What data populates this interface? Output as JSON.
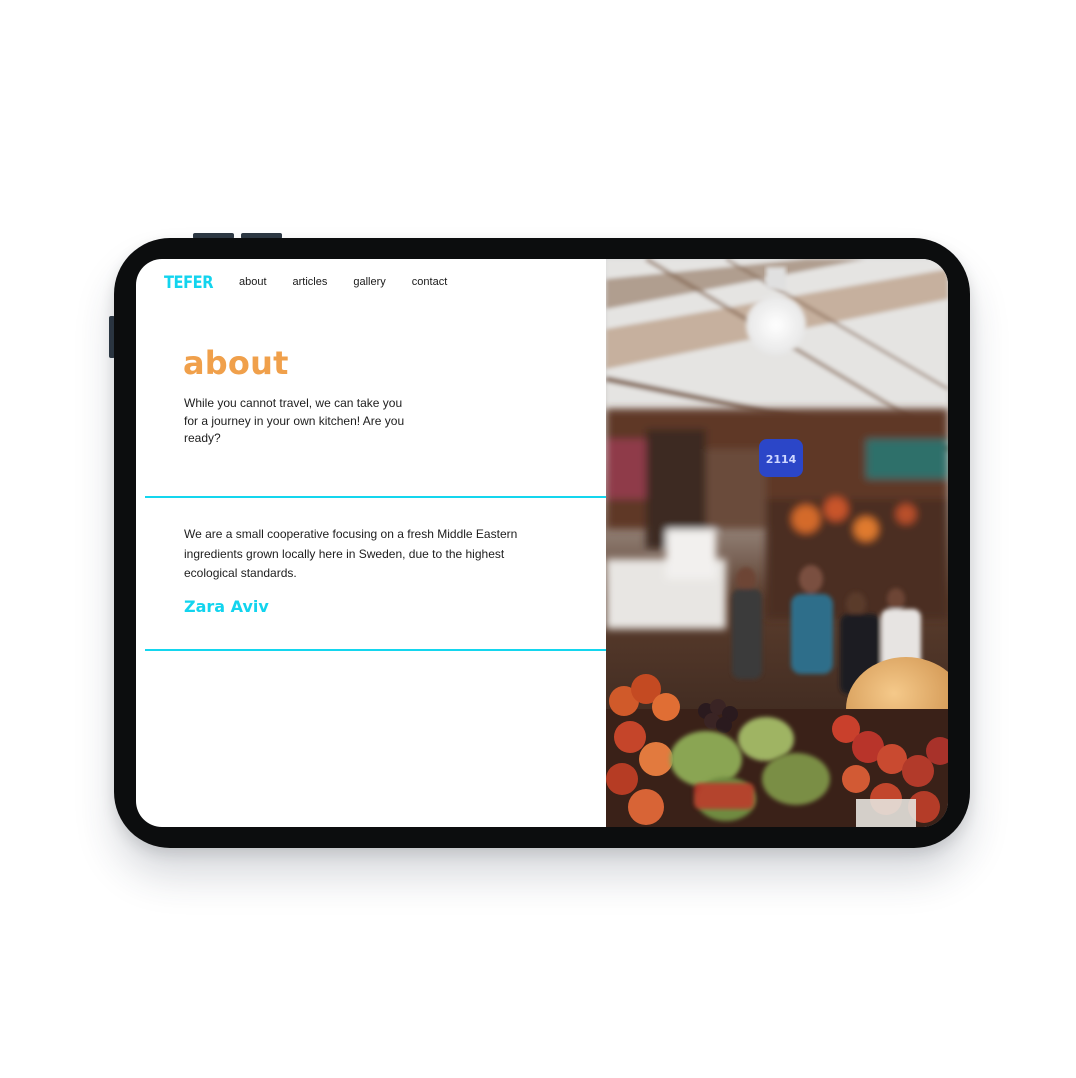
{
  "site": {
    "logo": "TEFER"
  },
  "nav": {
    "items": [
      {
        "label": "about"
      },
      {
        "label": "articles"
      },
      {
        "label": "gallery"
      },
      {
        "label": "contact"
      }
    ]
  },
  "about": {
    "title": "about",
    "intro": "While you cannot travel, we can take you for a journey in your own kitchen! Are you ready?"
  },
  "cooperative": {
    "text": "We are a small cooperative focusing on a fresh Middle Eastern ingredients grown locally here in Sweden, due to the highest ecological standards.",
    "author": "Zara Aviv"
  },
  "photo": {
    "sign_text": "2114"
  },
  "colors": {
    "accent_cyan": "#14d6ee",
    "accent_orange": "#f0a04b",
    "frame": "#0c0d0e"
  }
}
